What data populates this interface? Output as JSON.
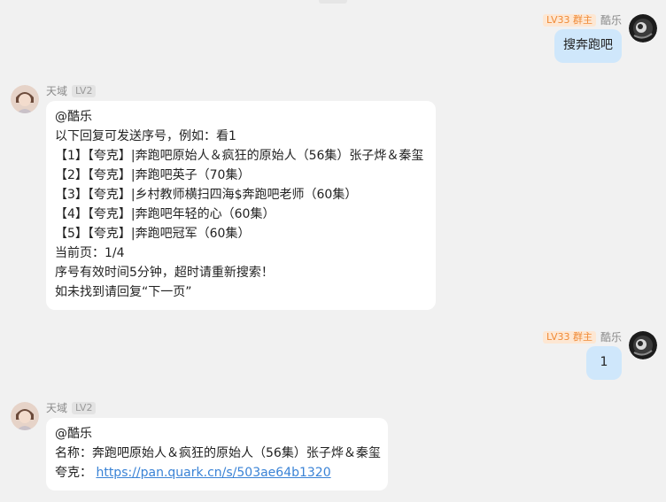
{
  "messages": [
    {
      "sender": "酷乐",
      "badge": "LV33 群主",
      "text": "搜奔跑吧"
    },
    {
      "sender": "天域",
      "badge": "LV2",
      "lines": [
        "@酷乐",
        "以下回复可发送序号，例如：看1",
        "【1】【夸克】|奔跑吧原始人＆疯狂的原始人（56集）张子烨＆秦玺",
        "【2】【夸克】|奔跑吧英子（70集）",
        "【3】【夸克】|乡村教师横扫四海$奔跑吧老师（60集）",
        "【4】【夸克】|奔跑吧年轻的心（60集）",
        "【5】【夸克】|奔跑吧冠军（60集）",
        "当前页：1/4",
        "序号有效时间5分钟，超时请重新搜索！",
        "如未找到请回复“下一页”"
      ]
    },
    {
      "sender": "酷乐",
      "badge": "LV33 群主",
      "text": "1"
    },
    {
      "sender": "天域",
      "badge": "LV2",
      "mention": "@酷乐",
      "name_line": "名称：奔跑吧原始人＆疯狂的原始人（56集）张子烨＆秦玺",
      "link_label": "夸克：",
      "link_url": "https://pan.quark.cn/s/503ae64b1320"
    }
  ],
  "colors": {
    "background": "#f1f1f1",
    "self_bubble": "#cfe7fb",
    "other_bubble": "#ffffff",
    "owner_badge_bg": "#fde7d3",
    "owner_badge_text": "#f08a36",
    "link": "#3a83d6"
  }
}
